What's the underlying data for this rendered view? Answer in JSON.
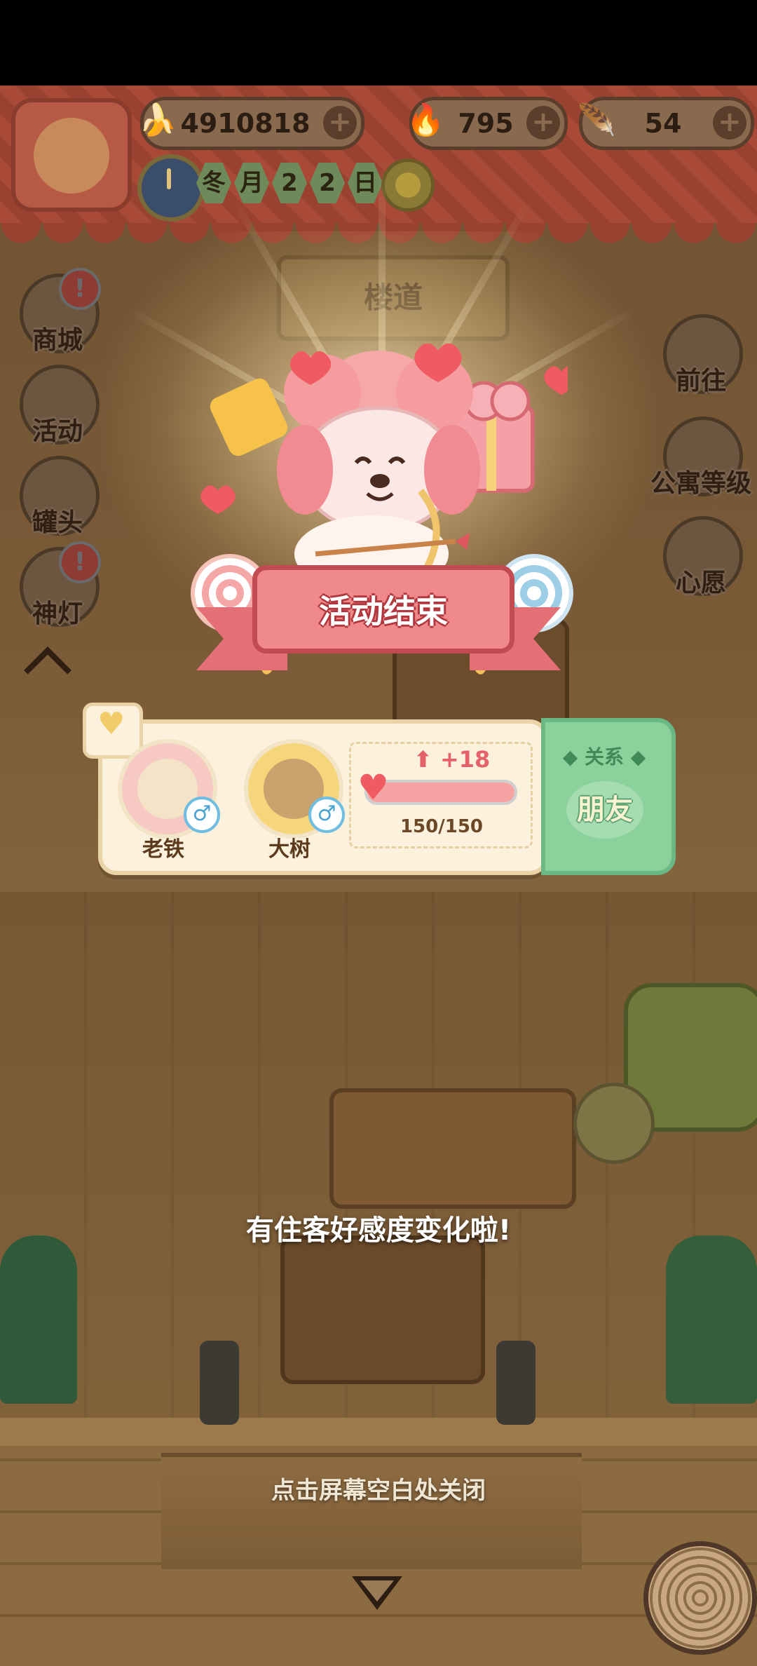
{
  "resources": {
    "bananas": "4910818",
    "blue_flame": "795",
    "feather": "54"
  },
  "date": {
    "chars": [
      "冬",
      "月",
      "2",
      "2",
      "日"
    ]
  },
  "scene": {
    "location_sign": "楼道"
  },
  "left_menu": [
    {
      "label": "商城",
      "alert": "!"
    },
    {
      "label": "活动",
      "alert": ""
    },
    {
      "label": "罐头",
      "alert": ""
    },
    {
      "label": "神灯",
      "alert": "!"
    }
  ],
  "right_menu": [
    {
      "label": "前往"
    },
    {
      "label": "公寓等级"
    },
    {
      "label": "心愿"
    }
  ],
  "popup": {
    "event_banner": "活动结束",
    "guest_a": {
      "name": "老铁",
      "gender": "♂"
    },
    "guest_b": {
      "name": "大树",
      "gender": "♂"
    },
    "affection_delta": "+18",
    "affection_text": "150/150",
    "affection_ratio": 1.0,
    "relation_title": "关系",
    "relation_value": "朋友",
    "message": "有住客好感度变化啦!",
    "close_hint": "点击屏幕空白处关闭"
  },
  "colors": {
    "banner_red": "#9a4231",
    "ribbon_pink": "#f08a8a",
    "relation_green": "#8ad19c",
    "affection_heart": "#ef5b63"
  }
}
